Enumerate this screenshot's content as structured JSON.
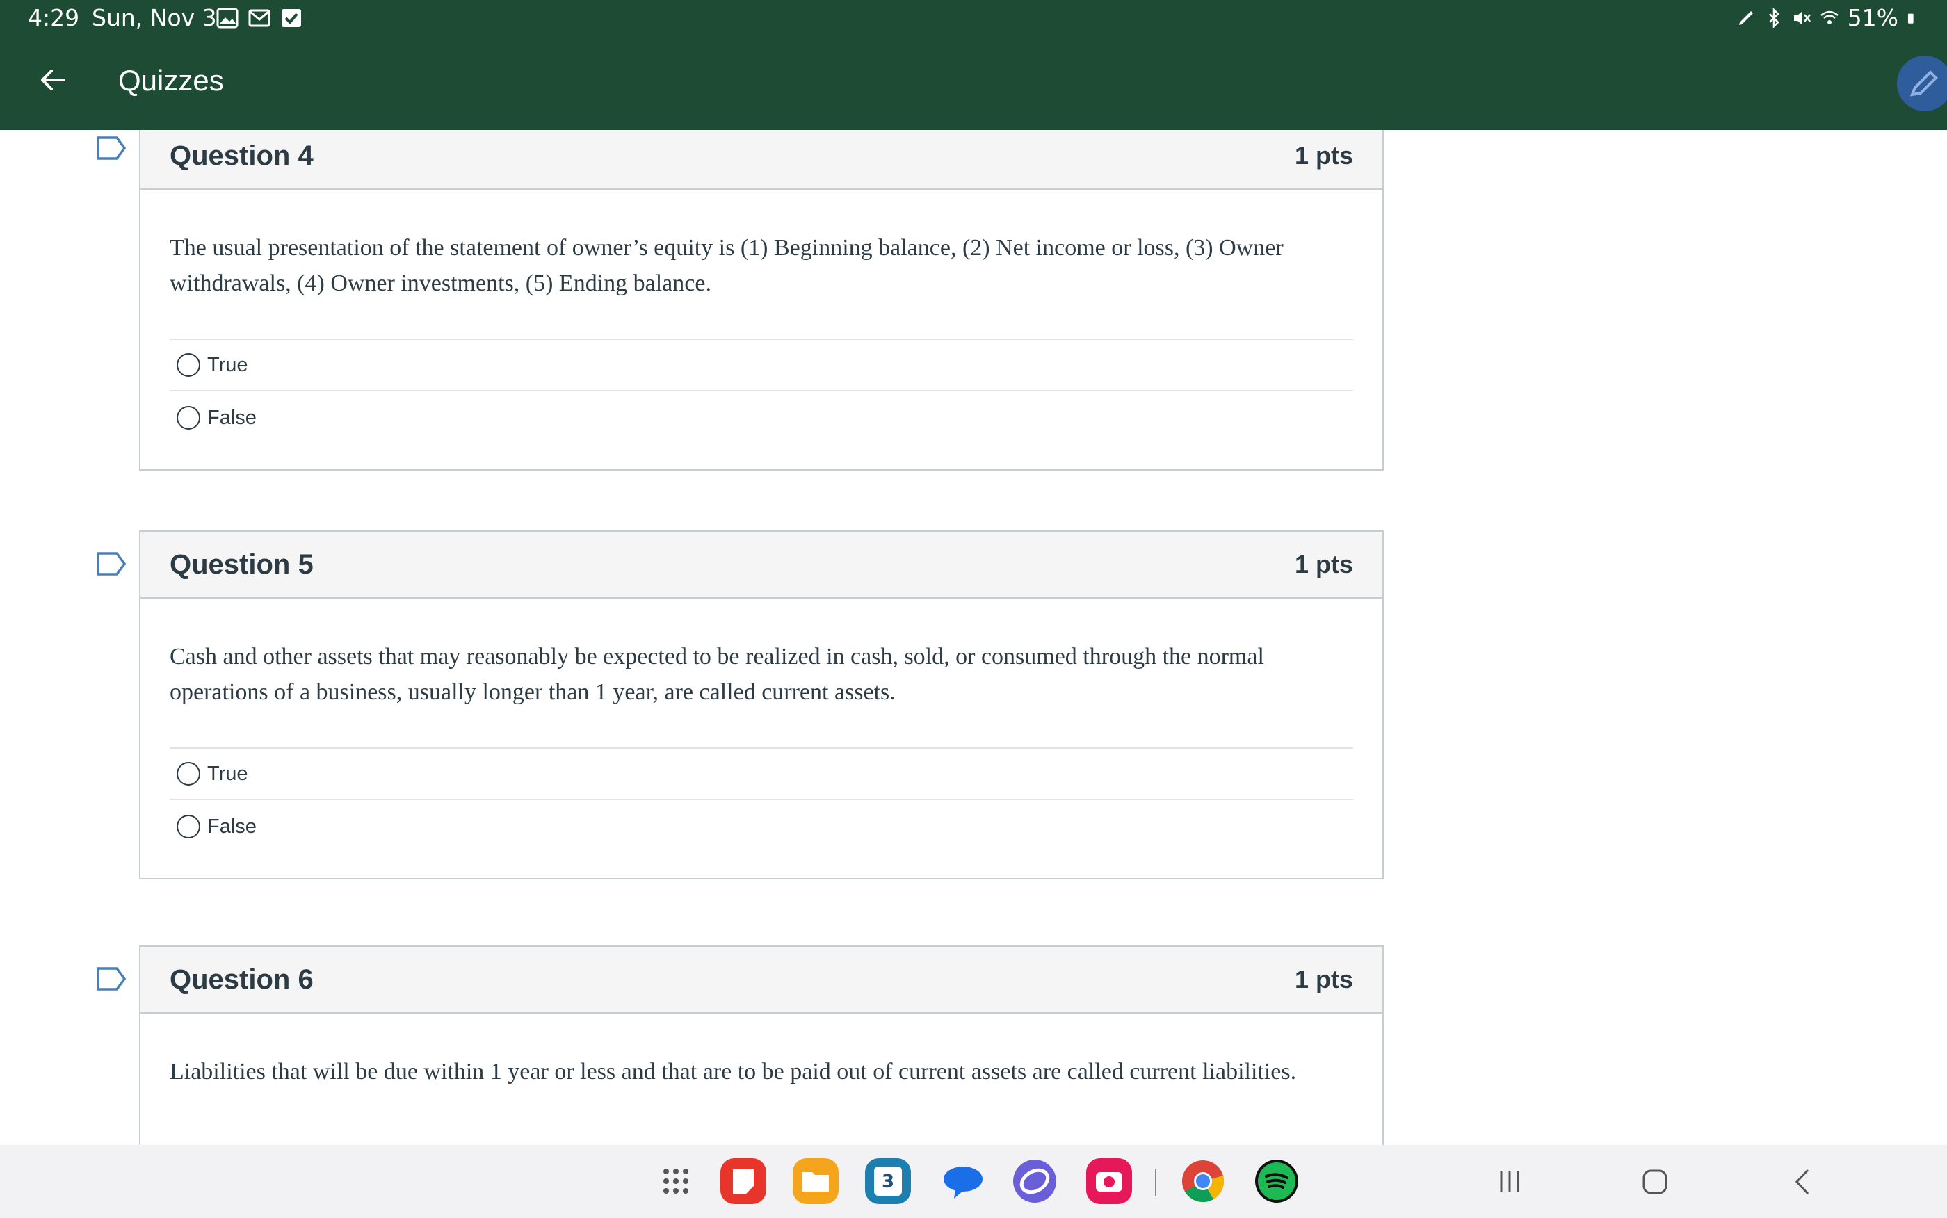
{
  "status_bar": {
    "time": "4:29",
    "date": "Sun, Nov 3",
    "battery": "51%"
  },
  "header": {
    "title": "Quizzes"
  },
  "questions": [
    {
      "title": "Question 4",
      "points": "1 pts",
      "text": "The usual presentation of the statement of owner’s equity is (1) Beginning balance, (2) Net income or loss, (3) Owner withdrawals, (4) Owner investments, (5) Ending balance.",
      "answers": [
        "True",
        "False"
      ]
    },
    {
      "title": "Question 5",
      "points": "1 pts",
      "text": "Cash and other assets that may reasonably be expected to be realized in cash, sold, or consumed through the normal operations of a business, usually longer than 1 year, are called current assets.",
      "answers": [
        "True",
        "False"
      ]
    },
    {
      "title": "Question 6",
      "points": "1 pts",
      "text": "Liabilities that will be due within 1 year or less and that are to be paid out of current assets are called current liabilities."
    }
  ],
  "dock": {
    "calendar_day": "3"
  },
  "colors": {
    "header_bg": "#1d4b33",
    "text": "#2d3b45",
    "border": "#c7cdd1"
  }
}
